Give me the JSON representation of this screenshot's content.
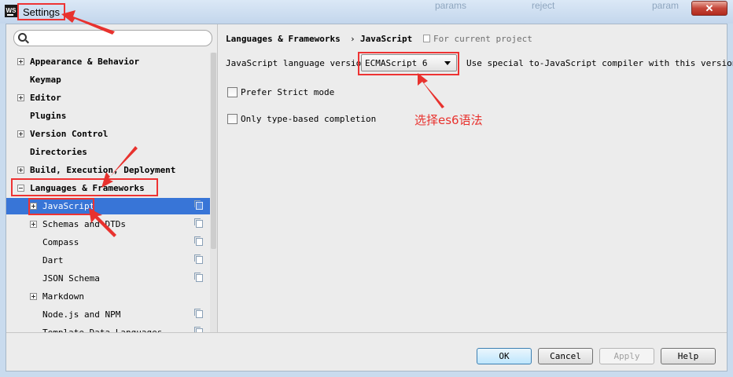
{
  "window": {
    "title": "Settings",
    "close_symbol": "✕",
    "app_icon": "WS",
    "background_tabs": [
      "params",
      "reject",
      "param"
    ]
  },
  "search": {
    "placeholder": "",
    "value": ""
  },
  "tree": [
    {
      "label": "Appearance & Behavior",
      "bold": true,
      "toggle": "plus",
      "level": 0
    },
    {
      "label": "Keymap",
      "bold": true,
      "toggle": "none",
      "level": 0
    },
    {
      "label": "Editor",
      "bold": true,
      "toggle": "plus",
      "level": 0
    },
    {
      "label": "Plugins",
      "bold": true,
      "toggle": "none",
      "level": 0
    },
    {
      "label": "Version Control",
      "bold": true,
      "toggle": "plus",
      "level": 0
    },
    {
      "label": "Directories",
      "bold": true,
      "toggle": "none",
      "level": 0
    },
    {
      "label": "Build, Execution, Deployment",
      "bold": true,
      "toggle": "plus",
      "level": 0
    },
    {
      "label": "Languages & Frameworks",
      "bold": true,
      "toggle": "minus",
      "level": 0
    },
    {
      "label": "JavaScript",
      "bold": false,
      "toggle": "plus",
      "level": 1,
      "selected": true,
      "project_icon": true
    },
    {
      "label": "Schemas and DTDs",
      "bold": false,
      "toggle": "plus",
      "level": 1,
      "project_icon": true
    },
    {
      "label": "Compass",
      "bold": false,
      "toggle": "none",
      "level": 1,
      "project_icon": true
    },
    {
      "label": "Dart",
      "bold": false,
      "toggle": "none",
      "level": 1,
      "project_icon": true
    },
    {
      "label": "JSON Schema",
      "bold": false,
      "toggle": "none",
      "level": 1,
      "project_icon": true
    },
    {
      "label": "Markdown",
      "bold": false,
      "toggle": "plus",
      "level": 1,
      "project_icon": false
    },
    {
      "label": "Node.js and NPM",
      "bold": false,
      "toggle": "none",
      "level": 1,
      "project_icon": true
    },
    {
      "label": "Template Data Languages",
      "bold": false,
      "toggle": "none",
      "level": 1,
      "project_icon": true
    }
  ],
  "breadcrumb": {
    "parent": "Languages & Frameworks",
    "separator": "›",
    "current": "JavaScript",
    "scope_note": "For current project"
  },
  "js_settings": {
    "language_version_label": "JavaScript language version",
    "language_version_value": "ECMAScript 6",
    "compiler_note": "Use special to-JavaScript compiler with this version",
    "prefer_strict_label": "Prefer Strict mode",
    "prefer_strict_checked": false,
    "type_based_label": "Only type-based completion",
    "type_based_checked": false
  },
  "annotation": {
    "text": "选择es6语法",
    "color": "#e8322e"
  },
  "buttons": {
    "ok": "OK",
    "cancel": "Cancel",
    "apply": "Apply",
    "help": "Help"
  },
  "colors": {
    "selection": "#3875d7",
    "annotation_red": "#e33333",
    "frame_blue": "#c9dbee"
  }
}
